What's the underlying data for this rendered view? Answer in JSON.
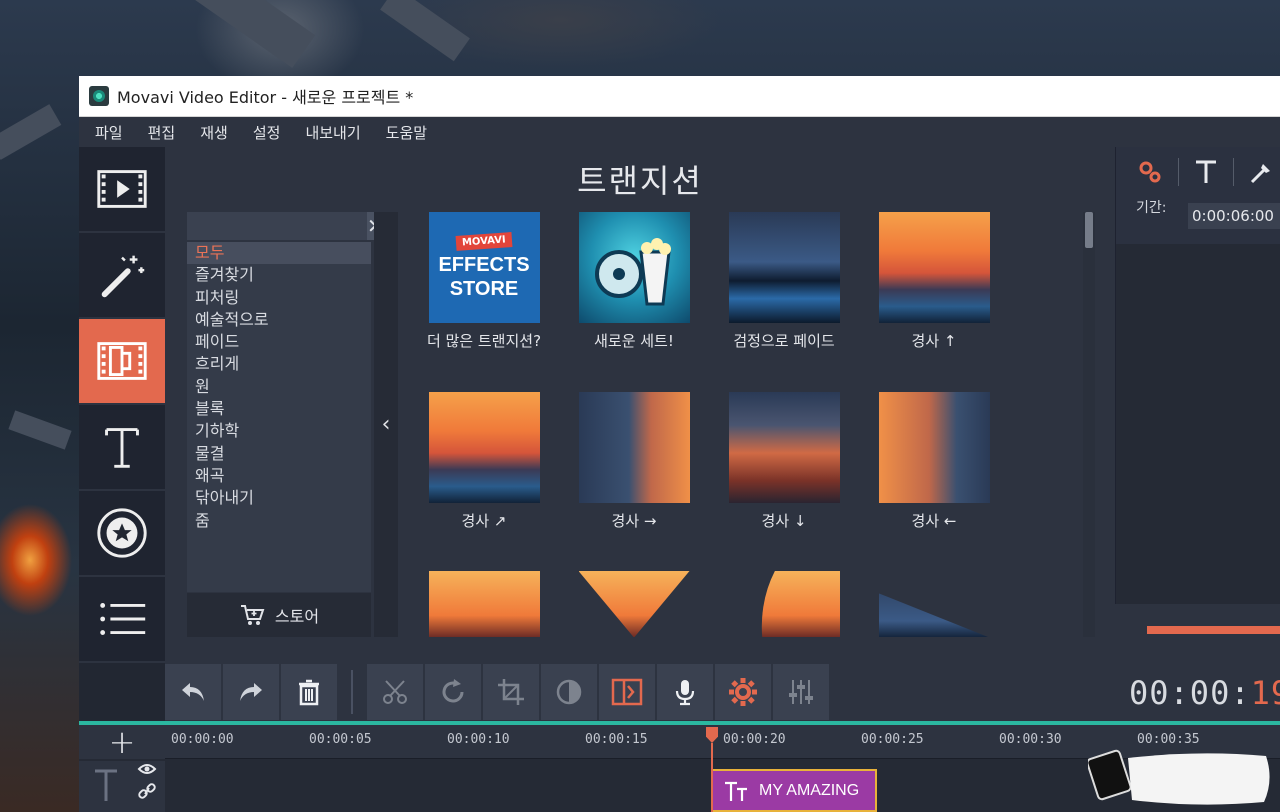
{
  "window": {
    "title": "Movavi Video Editor - 새로운 프로젝트 *"
  },
  "menu": [
    "파일",
    "편집",
    "재생",
    "설정",
    "내보내기",
    "도움말"
  ],
  "toolstrip": [
    {
      "name": "import-media",
      "icon": "film-play-icon",
      "active": false
    },
    {
      "name": "filters",
      "icon": "magic-wand-icon",
      "active": false
    },
    {
      "name": "transitions",
      "icon": "transition-film-icon",
      "active": true
    },
    {
      "name": "titles",
      "icon": "text-T-icon",
      "active": false
    },
    {
      "name": "stickers",
      "icon": "star-sticker-icon",
      "active": false
    },
    {
      "name": "more",
      "icon": "list-icon",
      "active": false
    }
  ],
  "panel": {
    "title": "트랜지션",
    "search": {
      "value": "",
      "placeholder": ""
    },
    "categories": [
      "모두",
      "즐겨찾기",
      "피처링",
      "예술적으로",
      "페이드",
      "흐리게",
      "원",
      "블록",
      "기하학",
      "물결",
      "왜곡",
      "닦아내기",
      "줌"
    ],
    "selected_category": "모두",
    "store_label": "스토어",
    "tiles": [
      {
        "label": "더 많은 트랜지션?",
        "thumb": "store",
        "store_tag": "MOVAVI",
        "store_text": "EFFECTS STORE"
      },
      {
        "label": "새로운 세트!",
        "thumb": "newset"
      },
      {
        "label": "검정으로 페이드",
        "thumb": "city"
      },
      {
        "label": "경사 ↑",
        "thumb": "sunset"
      },
      {
        "label": "경사 ↗",
        "thumb": "sunset"
      },
      {
        "label": "경사 →",
        "thumb": "mix-r"
      },
      {
        "label": "경사 ↓",
        "thumb": "mix-v"
      },
      {
        "label": "경사 ←",
        "thumb": "mix-l"
      },
      {
        "label": "",
        "thumb": "sunset-dark"
      },
      {
        "label": "",
        "thumb": "sunset-dark"
      },
      {
        "label": "",
        "thumb": "sunset-dark"
      },
      {
        "label": "",
        "thumb": "city"
      }
    ]
  },
  "right": {
    "duration_label": "기간:",
    "duration_value": "0:00:06:00",
    "time_main": "00:00:",
    "time_highlight": "19"
  },
  "timeline": {
    "ticks": [
      "00:00:00",
      "00:00:05",
      "00:00:10",
      "00:00:15",
      "00:00:20",
      "00:00:25",
      "00:00:30",
      "00:00:35"
    ],
    "clip_label": "MY AMAZING"
  },
  "colors": {
    "accent": "#e3694e",
    "timeline_teal": "#2bb7a0",
    "clip": "#9b3aa4",
    "clip_border": "#e8b23a"
  }
}
